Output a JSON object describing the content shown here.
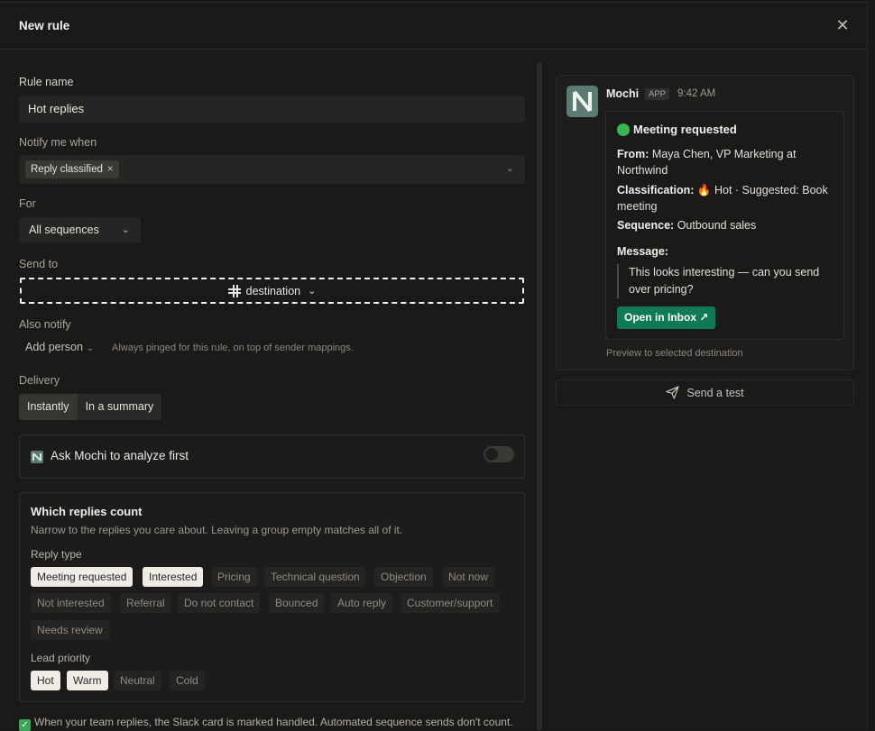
{
  "header": {
    "title": "New rule",
    "close": "✕"
  },
  "rule_name": {
    "label": "Rule name",
    "value": "Hot replies"
  },
  "notify": {
    "label": "Notify me when",
    "chip": "Reply classified",
    "chip_remove": "×",
    "chevron": "⌄"
  },
  "for": {
    "label": "For",
    "value": "All sequences",
    "chevron": "⌄"
  },
  "send_to": {
    "label": "Send to",
    "value": "destination",
    "chevron": "⌄"
  },
  "also_notify": {
    "label": "Also notify",
    "add_person": "Add person",
    "chevron": "⌄",
    "hint": "Always pinged for this rule, on top of sender mappings."
  },
  "delivery": {
    "label": "Delivery",
    "options": [
      "Instantly",
      "In a summary"
    ],
    "selected": "Instantly"
  },
  "analyze": {
    "label": "Ask Mochi to analyze first",
    "enabled": false
  },
  "replies_count": {
    "title": "Which replies count",
    "subtitle": "Narrow to the replies you care about. Leaving a group empty matches all of it.",
    "reply_type_label": "Reply type",
    "reply_types": [
      {
        "label": "Meeting requested",
        "selected": true
      },
      {
        "label": "Interested",
        "selected": true
      },
      {
        "label": "Pricing",
        "selected": false
      },
      {
        "label": "Technical question",
        "selected": false
      },
      {
        "label": "Objection",
        "selected": false
      },
      {
        "label": "Not now",
        "selected": false
      },
      {
        "label": "Not interested",
        "selected": false
      },
      {
        "label": "Referral",
        "selected": false
      },
      {
        "label": "Do not contact",
        "selected": false
      },
      {
        "label": "Bounced",
        "selected": false
      },
      {
        "label": "Auto reply",
        "selected": false
      },
      {
        "label": "Customer/support",
        "selected": false
      },
      {
        "label": "Needs review",
        "selected": false
      }
    ],
    "priority_label": "Lead priority",
    "priorities": [
      {
        "label": "Hot",
        "selected": true
      },
      {
        "label": "Warm",
        "selected": true
      },
      {
        "label": "Neutral",
        "selected": false
      },
      {
        "label": "Cold",
        "selected": false
      }
    ]
  },
  "footnote": {
    "check": "✓",
    "text": "When your team replies, the Slack card is marked handled. Automated sequence sends don't count."
  },
  "preview": {
    "sender": "Mochi",
    "app_tag": "APP",
    "time": "9:42 AM",
    "card_title": "Meeting requested",
    "from_label": "From:",
    "from_value": "Maya Chen, VP Marketing at Northwind",
    "class_label": "Classification:",
    "class_value": "🔥 Hot · Suggested: Book meeting",
    "seq_label": "Sequence:",
    "seq_value": "Outbound sales",
    "msg_label": "Message:",
    "msg_value": "This looks interesting — can you send over pricing?",
    "button": "Open in Inbox",
    "button_icon": "↗",
    "footer": "Preview to selected destination"
  },
  "send_test": {
    "label": "Send a test"
  },
  "colors": {
    "accent_green": "#0f7a55",
    "status_green": "#3bb352",
    "chip_selected_bg": "#efebe5"
  }
}
